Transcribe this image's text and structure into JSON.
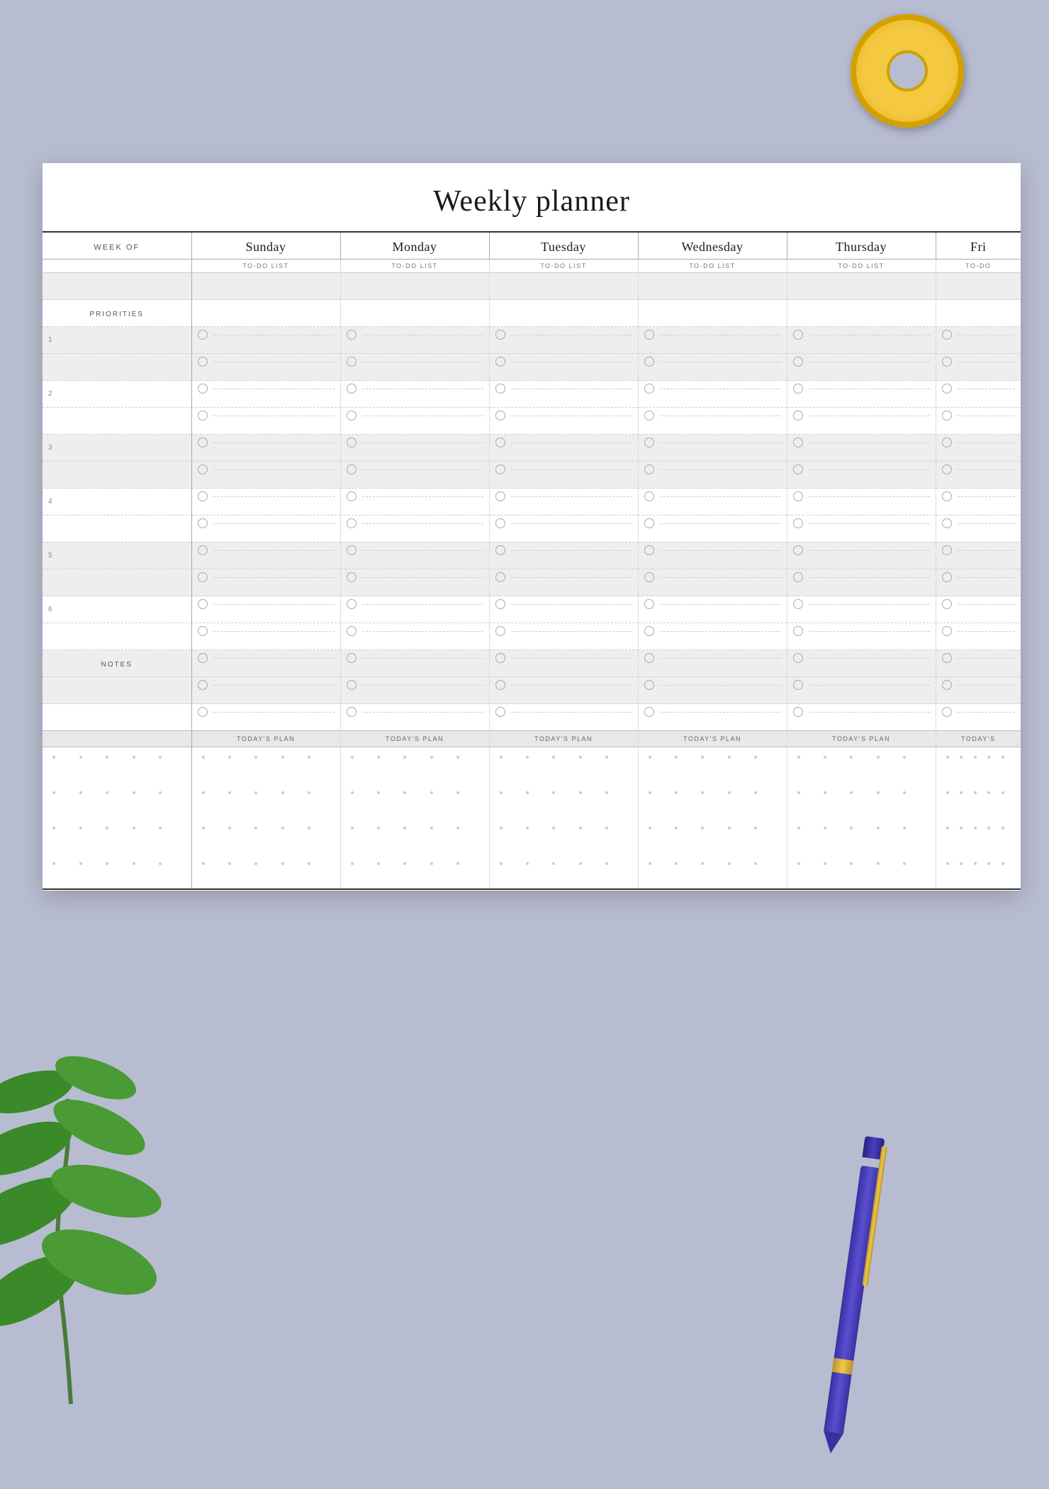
{
  "title": "Weekly planner",
  "header": {
    "week_of": "WEEK OF",
    "days": [
      "Sunday",
      "Monday",
      "Tuesday",
      "Wednesday",
      "Thursday",
      "Fri"
    ],
    "todo_labels": [
      "TO-DO LIST",
      "TO-DO LIST",
      "TO-DO LIST",
      "TO-DO LIST",
      "TO-DO LIST",
      "TO-DO"
    ]
  },
  "left_column": {
    "priorities_label": "PRIORITIES",
    "priority_numbers": [
      "1",
      "2",
      "3",
      "4",
      "5",
      "6"
    ],
    "notes_label": "NOTES"
  },
  "todays_plan_labels": [
    "TODAY'S PLAN",
    "TODAY'S PLAN",
    "TODAY'S PLAN",
    "TODAY'S PLAN",
    "TODAY'S PLAN",
    "TODAY'S"
  ],
  "colors": {
    "background": "#b8bcd0",
    "paper": "#ffffff",
    "shaded_row": "#eeeeee",
    "border_dark": "#333333",
    "border_light": "#aaaaaa",
    "text_dark": "#1a1a1a",
    "text_muted": "#777777"
  }
}
